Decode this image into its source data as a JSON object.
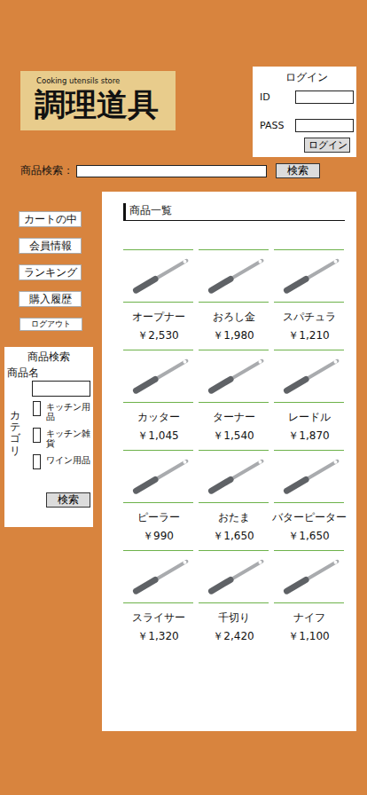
{
  "logo": {
    "subtitle": "Cooking utensils store",
    "title": "調理道具"
  },
  "login": {
    "title": "ログイン",
    "id_label": "ID",
    "pass_label": "PASS",
    "button": "ログイン"
  },
  "search": {
    "label": "商品検索：",
    "button": "検索"
  },
  "sidebar": {
    "items": [
      {
        "label": "カートの中",
        "kind": "normal"
      },
      {
        "label": "会員情報",
        "kind": "normal"
      },
      {
        "label": "ランキング",
        "kind": "normal"
      },
      {
        "label": "購入履歴",
        "kind": "normal"
      },
      {
        "label": "ログアウト",
        "kind": "small"
      }
    ]
  },
  "filter": {
    "title": "商品検索",
    "name_label": "商品名",
    "category_label": "カテゴリ",
    "categories": [
      {
        "label": "キッチン用品",
        "checked": false
      },
      {
        "label": "キッチン雑貨",
        "checked": false
      },
      {
        "label": "ワイン用品",
        "checked": false
      }
    ],
    "button": "検索"
  },
  "products": {
    "title": "商品一覧",
    "items": [
      {
        "name": "オープナー",
        "price": "￥2,530"
      },
      {
        "name": "おろし金",
        "price": "￥1,980"
      },
      {
        "name": "スパチュラ",
        "price": "￥1,210"
      },
      {
        "name": "カッター",
        "price": "￥1,045"
      },
      {
        "name": "ターナー",
        "price": "￥1,540"
      },
      {
        "name": "レードル",
        "price": "￥1,870"
      },
      {
        "name": "ピーラー",
        "price": "￥990"
      },
      {
        "name": "おたま",
        "price": "￥1,650"
      },
      {
        "name": "バターピーター",
        "price": "￥1,650"
      },
      {
        "name": "スライサー",
        "price": "￥1,320"
      },
      {
        "name": "千切り",
        "price": "￥2,420"
      },
      {
        "name": "ナイフ",
        "price": "￥1,100"
      }
    ]
  }
}
